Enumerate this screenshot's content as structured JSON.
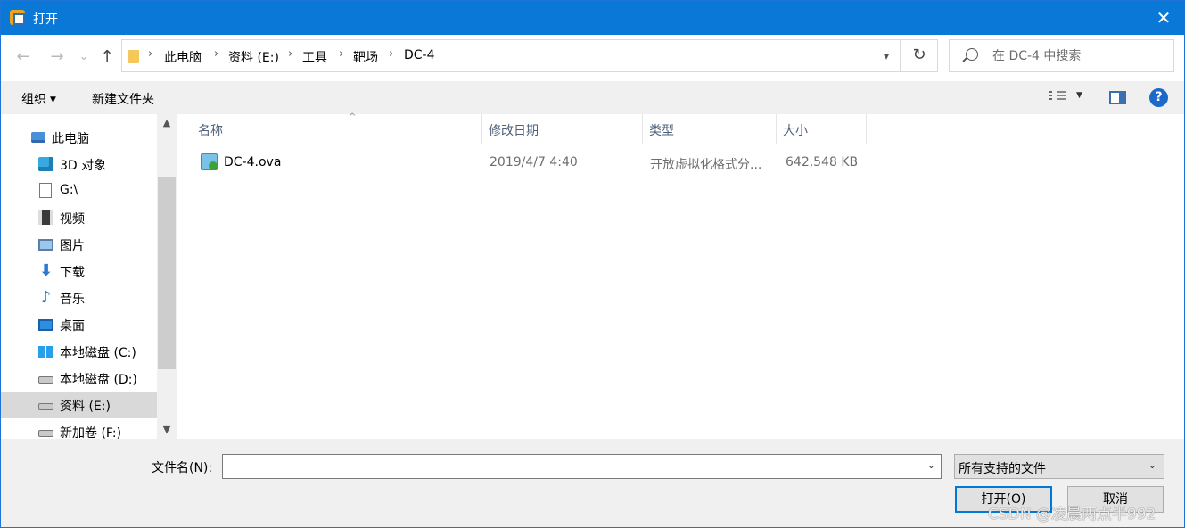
{
  "window": {
    "title": "打开",
    "close_label": "✕"
  },
  "nav": {
    "back": "←",
    "forward": "→",
    "recent": "⌄",
    "up": "↑",
    "breadcrumb": [
      "此电脑",
      "资料 (E:)",
      "工具",
      "靶场",
      "DC-4"
    ],
    "separator": "›",
    "refresh": "↻",
    "search_placeholder": "在 DC-4 中搜索"
  },
  "toolbar": {
    "organize": "组织",
    "new_folder": "新建文件夹",
    "help": "?"
  },
  "tree": [
    {
      "label": "此电脑",
      "icon": "computer-icon"
    },
    {
      "label": "3D 对象",
      "icon": "3d-objects-icon"
    },
    {
      "label": "G:\\",
      "icon": "drive-icon"
    },
    {
      "label": "视频",
      "icon": "video-icon"
    },
    {
      "label": "图片",
      "icon": "pictures-icon"
    },
    {
      "label": "下载",
      "icon": "download-icon"
    },
    {
      "label": "音乐",
      "icon": "music-icon"
    },
    {
      "label": "桌面",
      "icon": "desktop-icon"
    },
    {
      "label": "本地磁盘 (C:)",
      "icon": "windows-drive-icon"
    },
    {
      "label": "本地磁盘 (D:)",
      "icon": "hard-drive-icon"
    },
    {
      "label": "资料 (E:)",
      "icon": "hard-drive-icon",
      "selected": true
    },
    {
      "label": "新加卷 (F:)",
      "icon": "hard-drive-icon"
    }
  ],
  "columns": {
    "name": "名称",
    "modified": "修改日期",
    "type": "类型",
    "size": "大小"
  },
  "files": [
    {
      "name": "DC-4.ova",
      "modified": "2019/4/7 4:40",
      "type": "开放虚拟化格式分...",
      "size": "642,548 KB",
      "icon": "ova-file-icon"
    }
  ],
  "bottom": {
    "filename_label": "文件名(N):",
    "filename_value": "",
    "filetype": "所有支持的文件",
    "open_label": "打开(O)",
    "cancel_label": "取消"
  },
  "watermark": "CSDN @凌晨两点半992",
  "colors": {
    "titlebar": "#0a78d7",
    "selected_row": "#d9d9d9",
    "accent": "#0078d7"
  }
}
